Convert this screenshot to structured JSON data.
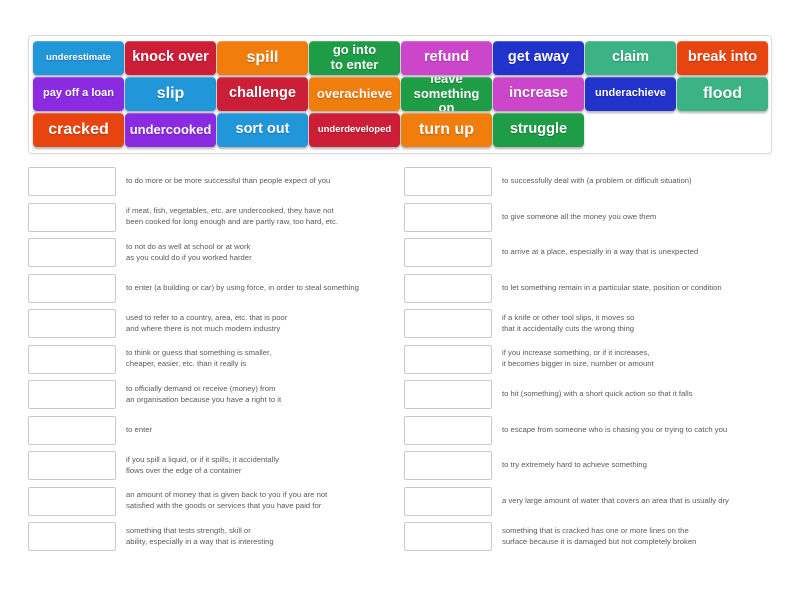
{
  "activity": {
    "type": "match-up",
    "tile_rows": [
      [
        {
          "label": "underestimate",
          "color": "#2196d8",
          "size": "s-xs"
        },
        {
          "label": "knock over",
          "color": "#cc1f37",
          "size": "s-lg"
        },
        {
          "label": "spill",
          "color": "#f07d0c",
          "size": "s-xl"
        },
        {
          "label": "go into\nto enter",
          "color": "#1f9d46",
          "size": "s-md",
          "lines": 2
        },
        {
          "label": "refund",
          "color": "#cc46cc",
          "size": "s-lg"
        },
        {
          "label": "get away",
          "color": "#2233cc",
          "size": "s-lg"
        },
        {
          "label": "claim",
          "color": "#3cb384",
          "size": "s-lg"
        },
        {
          "label": "break into",
          "color": "#e8440f",
          "size": "s-lg"
        }
      ],
      [
        {
          "label": "pay off a loan",
          "color": "#8a2be2",
          "size": "s-sm"
        },
        {
          "label": "slip",
          "color": "#2196d8",
          "size": "s-xl"
        },
        {
          "label": "challenge",
          "color": "#cc1f37",
          "size": "s-lg"
        },
        {
          "label": "overachieve",
          "color": "#f07d0c",
          "size": "s-md"
        },
        {
          "label": "leave\nsomething on",
          "color": "#1f9d46",
          "size": "s-md",
          "lines": 2
        },
        {
          "label": "increase",
          "color": "#cc46cc",
          "size": "s-lg"
        },
        {
          "label": "underachieve",
          "color": "#2233cc",
          "size": "s-sm"
        },
        {
          "label": "flood",
          "color": "#3cb384",
          "size": "s-xl"
        }
      ],
      [
        {
          "label": "cracked",
          "color": "#e8440f",
          "size": "s-xl"
        },
        {
          "label": "undercooked",
          "color": "#8a2be2",
          "size": "s-md"
        },
        {
          "label": "sort out",
          "color": "#2196d8",
          "size": "s-lg"
        },
        {
          "label": "underdeveloped",
          "color": "#cc1f37",
          "size": "s-xs"
        },
        {
          "label": "turn up",
          "color": "#f07d0c",
          "size": "s-xl"
        },
        {
          "label": "struggle",
          "color": "#1f9d46",
          "size": "s-lg"
        }
      ]
    ],
    "left_column": [
      {
        "answer": "",
        "definition": "to do more or be more successful than people expect of you"
      },
      {
        "answer": "",
        "definition": "if meat, fish, vegetables, etc. are undercooked, they have not\nbeen cooked for long enough and are partly raw, too hard, etc."
      },
      {
        "answer": "",
        "definition": "to not do as well at school or at work\nas you could do if you worked harder"
      },
      {
        "answer": "",
        "definition": "to enter (a building or car) by using force, in order to steal something"
      },
      {
        "answer": "",
        "definition": "used to refer to a country, area, etc. that is poor\nand where there is not much modern industry"
      },
      {
        "answer": "",
        "definition": "to think or guess that something is smaller,\ncheaper, easier, etc. than it really is"
      },
      {
        "answer": "",
        "definition": "to officially demand or receive (money) from\nan organisation because you have a right to it"
      },
      {
        "answer": "",
        "definition": "to enter"
      },
      {
        "answer": "",
        "definition": "if you spill a liquid, or if it spills, it accidentally\nflows over the edge of a container"
      },
      {
        "answer": "",
        "definition": "an amount of money that is given back to you if you are not\nsatisfied with the goods or services that you have paid for"
      },
      {
        "answer": "",
        "definition": "something that tests strength, skill or\nability, especially in a way that is interesting"
      }
    ],
    "right_column": [
      {
        "answer": "",
        "definition": "to successfully deal with (a problem or difficult situation)"
      },
      {
        "answer": "",
        "definition": "to give someone all the money you owe them"
      },
      {
        "answer": "",
        "definition": "to arrive at a place, especially in a way that is unexpected"
      },
      {
        "answer": "",
        "definition": "to let something remain in a particular state, position or condition"
      },
      {
        "answer": "",
        "definition": "if a knife or other tool slips, it moves so\nthat it accidentally cuts the wrong thing"
      },
      {
        "answer": "",
        "definition": "if you increase something, or if it increases,\nit becomes bigger in size, number or amount"
      },
      {
        "answer": "",
        "definition": "to hit (something) with a short quick action so that it falls"
      },
      {
        "answer": "",
        "definition": "to escape from someone who is chasing you or trying to catch you"
      },
      {
        "answer": "",
        "definition": "to try extremely hard to achieve something"
      },
      {
        "answer": "",
        "definition": "a very large amount of water that covers an area that is usually dry"
      },
      {
        "answer": "",
        "definition": "something that is cracked has one or more lines on the\nsurface because it is damaged but not completely broken"
      }
    ]
  }
}
